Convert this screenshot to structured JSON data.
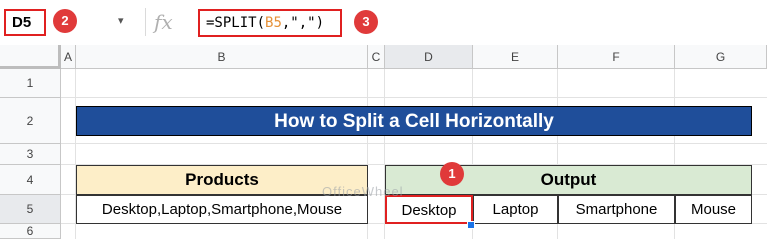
{
  "formula_bar": {
    "name_box": "D5",
    "dropdown_icon": "▾",
    "fx_label": "fx",
    "formula_prefix": "=SPLIT(",
    "formula_ref": "B5",
    "formula_suffix": ",\",\")"
  },
  "badges": [
    "1",
    "2",
    "3"
  ],
  "columns": [
    "A",
    "B",
    "C",
    "D",
    "E",
    "F",
    "G"
  ],
  "rows": [
    "1",
    "2",
    "3",
    "4",
    "5",
    "6"
  ],
  "sheet": {
    "title": "How to Split a Cell Horizontally",
    "products_header": "Products",
    "products_value": "Desktop,Laptop,Smartphone,Mouse",
    "output_header": "Output",
    "output_values": [
      "Desktop",
      "Laptop",
      "Smartphone",
      "Mouse"
    ],
    "watermark": "OfficeWheel"
  },
  "colors": {
    "title_bg": "#1f4e9a",
    "products_header_bg": "#fdeec8",
    "output_header_bg": "#d9ead3",
    "highlight_red": "#e02020"
  }
}
